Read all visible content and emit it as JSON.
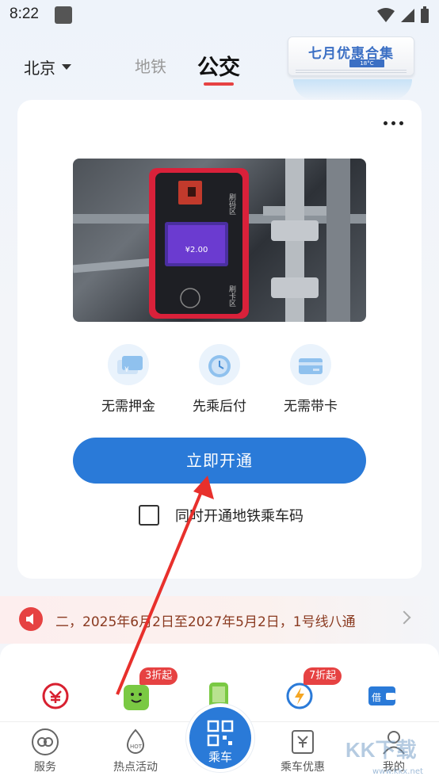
{
  "status_bar": {
    "time": "8:22"
  },
  "header": {
    "city": "北京",
    "tabs": [
      {
        "label": "地铁",
        "active": false
      },
      {
        "label": "公交",
        "active": true
      }
    ],
    "promo": {
      "title": "七月优惠合集",
      "temp": "18°C"
    }
  },
  "card": {
    "features": [
      {
        "label": "无需押金",
        "icon": "wallet-icon"
      },
      {
        "label": "先乘后付",
        "icon": "clock-icon"
      },
      {
        "label": "无需带卡",
        "icon": "card-icon"
      }
    ],
    "photo": {
      "reader_label": "刷码区",
      "fare": "¥2.00",
      "tap_label": "刷卡区"
    },
    "cta_label": "立即开通",
    "checkbox_label": "同时开通地铁乘车码"
  },
  "notice": {
    "text": "二，2025年6月2日至2027年5月2日，1号线八通"
  },
  "services": {
    "badges": [
      "3折起",
      "7折起"
    ]
  },
  "tab_bar": {
    "items": [
      {
        "label": "服务"
      },
      {
        "label": "热点活动"
      },
      {
        "label": "乘车"
      },
      {
        "label": "乘车优惠"
      },
      {
        "label": "我的"
      }
    ]
  },
  "watermark": {
    "text": "KK下载",
    "sub": "www.kkx.net"
  },
  "colors": {
    "accent": "#2a7ad8",
    "red": "#e64242"
  }
}
